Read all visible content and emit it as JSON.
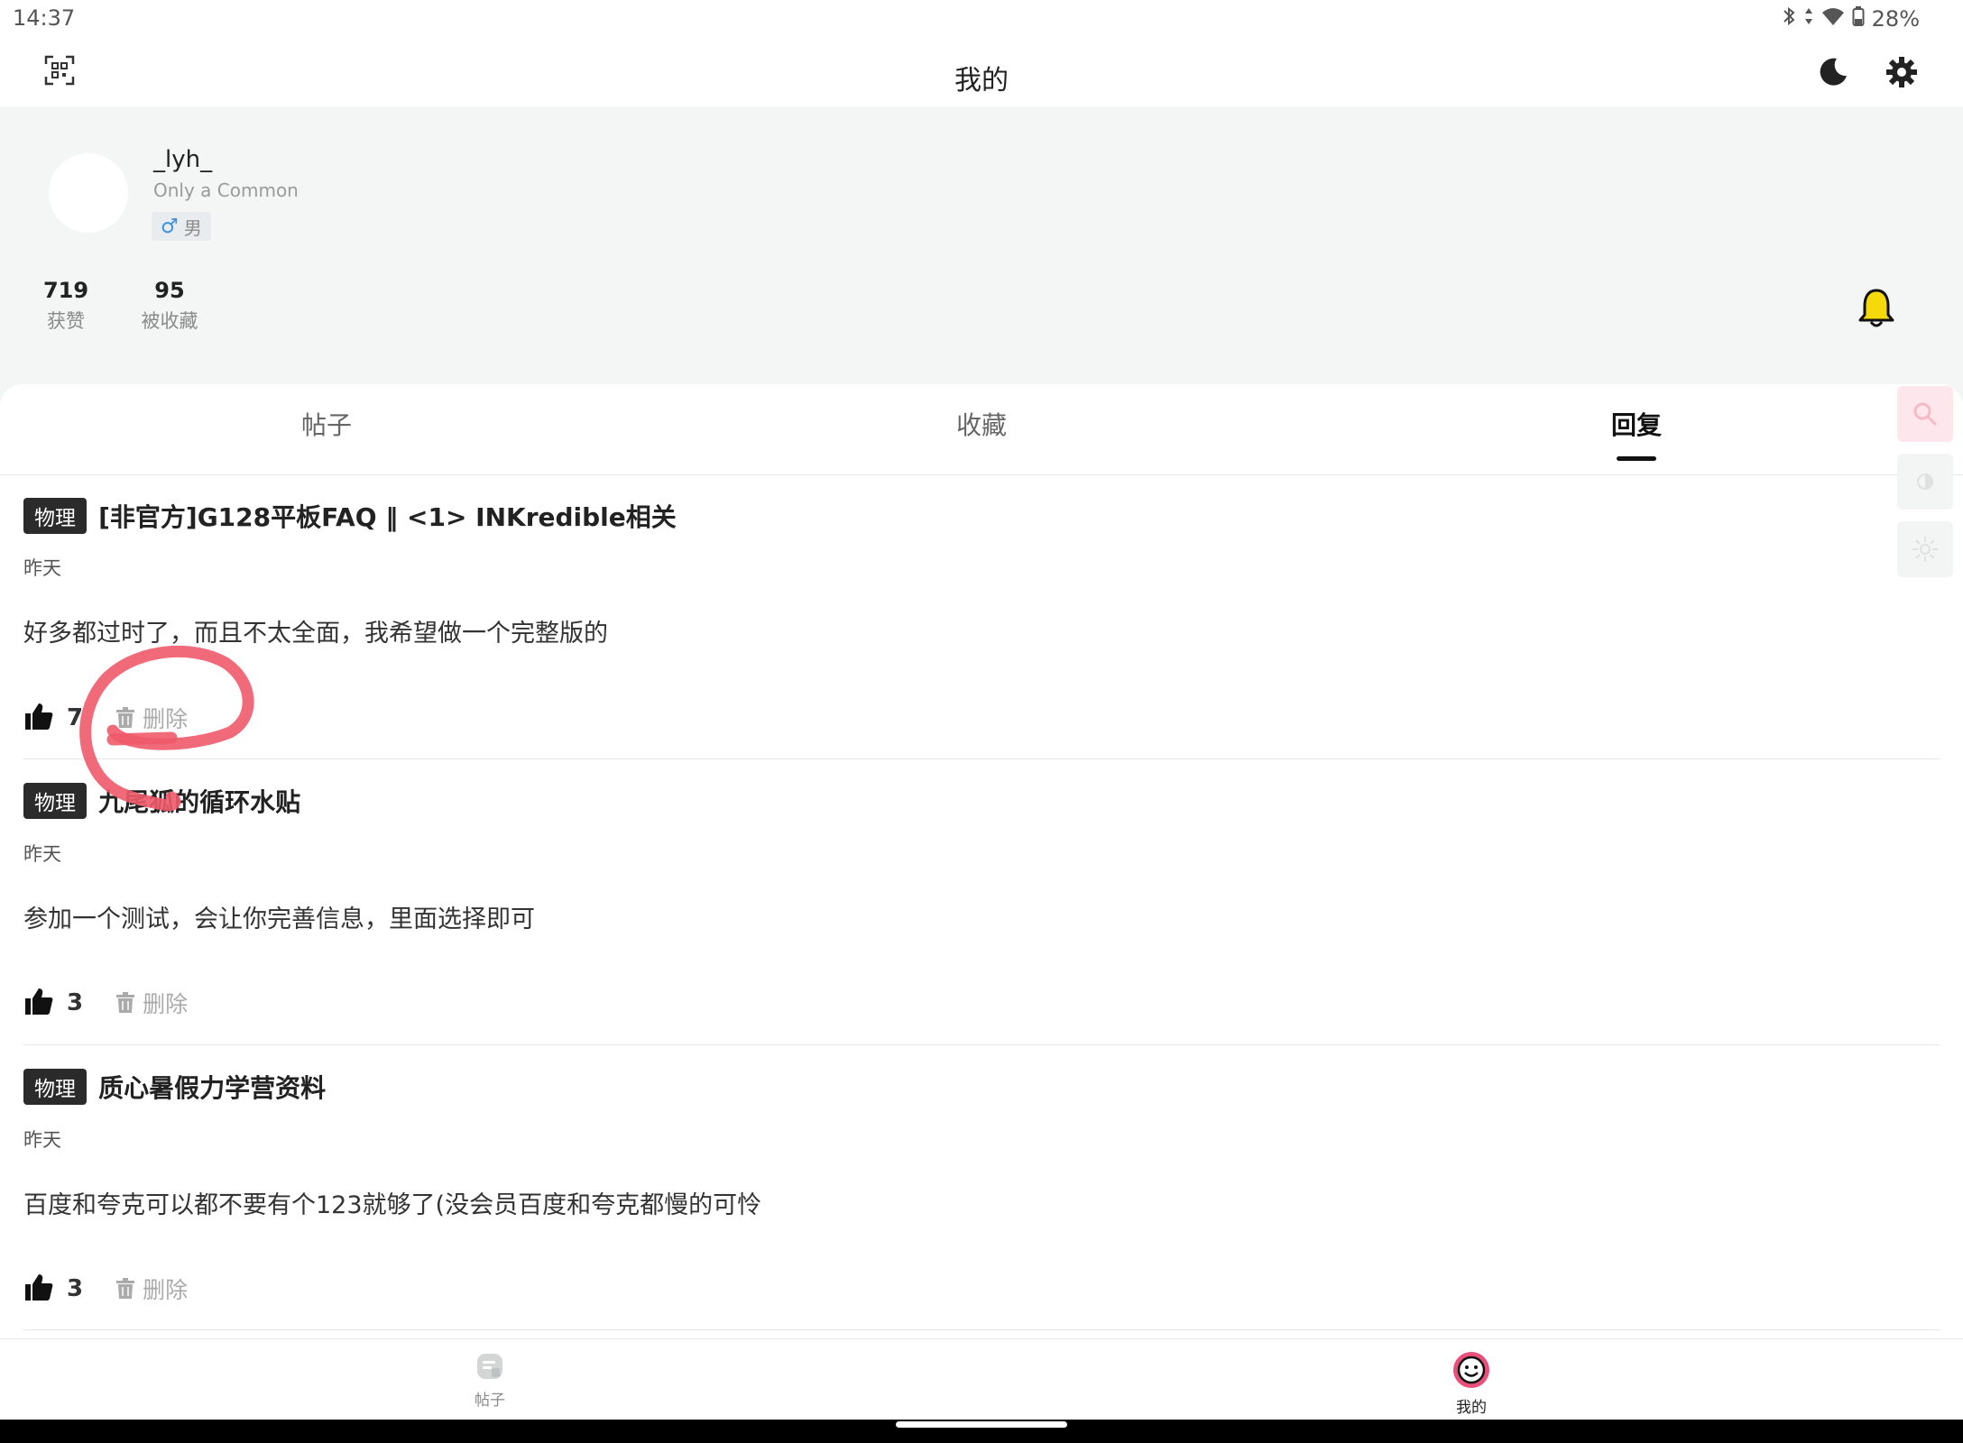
{
  "status_bar": {
    "time": "14:37",
    "battery": "28%"
  },
  "app_bar": {
    "title": "我的"
  },
  "profile": {
    "username": "_lyh_",
    "bio": "Only a Common",
    "gender_symbol": "♂",
    "gender": "男",
    "stats": [
      {
        "value": "719",
        "label": "获赞"
      },
      {
        "value": "95",
        "label": "被收藏"
      }
    ]
  },
  "tabs": [
    {
      "label": "帖子"
    },
    {
      "label": "收藏"
    },
    {
      "label": "回复"
    }
  ],
  "active_tab": "回复",
  "replies": [
    {
      "tag": "物理",
      "title": "[非官方]G128平板FAQ ‖ <1> INKredible相关",
      "date": "昨天",
      "content": "好多都过时了，而且不太全面，我希望做一个完整版的",
      "likes": "7",
      "delete_label": "删除"
    },
    {
      "tag": "物理",
      "title": "九尾狐的循环水贴",
      "date": "昨天",
      "content": "参加一个测试，会让你完善信息，里面选择即可",
      "likes": "3",
      "delete_label": "删除"
    },
    {
      "tag": "物理",
      "title": "质心暑假力学营资料",
      "date": "昨天",
      "content": "百度和夸克可以都不要有个123就够了(没会员百度和夸克都慢的可怜",
      "likes": "3",
      "delete_label": "删除"
    }
  ],
  "bottom_nav": [
    {
      "label": "帖子",
      "icon": "posts-icon"
    },
    {
      "label": "我的",
      "icon": "smiley-icon"
    }
  ],
  "colors": {
    "accent_pink": "#e8507a",
    "bell_yellow": "#f5d90a",
    "annotation_red": "#f05a6a",
    "profile_bg": "#f4f5f5"
  }
}
